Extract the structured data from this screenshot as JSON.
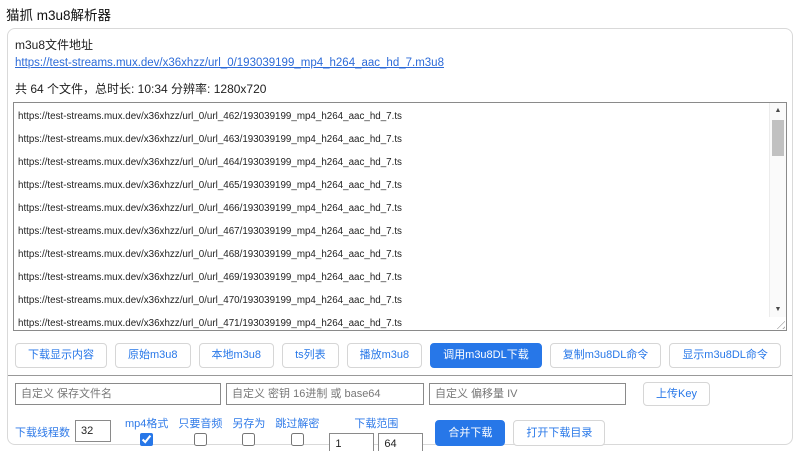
{
  "page": {
    "title": "猫抓 m3u8解析器"
  },
  "header": {
    "url_label": "m3u8文件地址",
    "url": "https://test-streams.mux.dev/x36xhzz/url_0/193039199_mp4_h264_aac_hd_7.m3u8",
    "info": "共 64 个文件，总时长: 10:34 分辨率: 1280x720"
  },
  "segment_list": {
    "lines": [
      "https://test-streams.mux.dev/x36xhzz/url_0/url_462/193039199_mp4_h264_aac_hd_7.ts",
      "https://test-streams.mux.dev/x36xhzz/url_0/url_463/193039199_mp4_h264_aac_hd_7.ts",
      "https://test-streams.mux.dev/x36xhzz/url_0/url_464/193039199_mp4_h264_aac_hd_7.ts",
      "https://test-streams.mux.dev/x36xhzz/url_0/url_465/193039199_mp4_h264_aac_hd_7.ts",
      "https://test-streams.mux.dev/x36xhzz/url_0/url_466/193039199_mp4_h264_aac_hd_7.ts",
      "https://test-streams.mux.dev/x36xhzz/url_0/url_467/193039199_mp4_h264_aac_hd_7.ts",
      "https://test-streams.mux.dev/x36xhzz/url_0/url_468/193039199_mp4_h264_aac_hd_7.ts",
      "https://test-streams.mux.dev/x36xhzz/url_0/url_469/193039199_mp4_h264_aac_hd_7.ts",
      "https://test-streams.mux.dev/x36xhzz/url_0/url_470/193039199_mp4_h264_aac_hd_7.ts",
      "https://test-streams.mux.dev/x36xhzz/url_0/url_471/193039199_mp4_h264_aac_hd_7.ts"
    ]
  },
  "icons": {
    "scroll_up": "▲",
    "scroll_down": "▼"
  },
  "actions": {
    "buttons": [
      {
        "label": "下载显示内容",
        "style": "outline"
      },
      {
        "label": "原始m3u8",
        "style": "outline"
      },
      {
        "label": "本地m3u8",
        "style": "outline"
      },
      {
        "label": "ts列表",
        "style": "outline"
      },
      {
        "label": "播放m3u8",
        "style": "outline"
      },
      {
        "label": "调用m3u8DL下载",
        "style": "primary"
      },
      {
        "label": "复制m3u8DL命令",
        "style": "outline"
      },
      {
        "label": "显示m3u8DL命令",
        "style": "outline"
      }
    ]
  },
  "custom_inputs": {
    "filename_placeholder": "自定义 保存文件名",
    "key_placeholder": "自定义 密钥 16进制 或 base64",
    "iv_placeholder": "自定义 偏移量 IV",
    "upload_key_label": "上传Key"
  },
  "download_controls": {
    "threads_label": "下载线程数",
    "threads_value": "32",
    "toggles": [
      {
        "label": "mp4格式",
        "checked": true
      },
      {
        "label": "只要音频",
        "checked": false
      },
      {
        "label": "另存为",
        "checked": false
      },
      {
        "label": "跳过解密",
        "checked": false
      }
    ],
    "range_label": "下载范围",
    "range_start": "1",
    "range_end": "64",
    "merge_label": "合并下载",
    "open_dir_label": "打开下载目录"
  },
  "colors": {
    "accent": "#2777e8",
    "link": "#2d6bd8"
  }
}
